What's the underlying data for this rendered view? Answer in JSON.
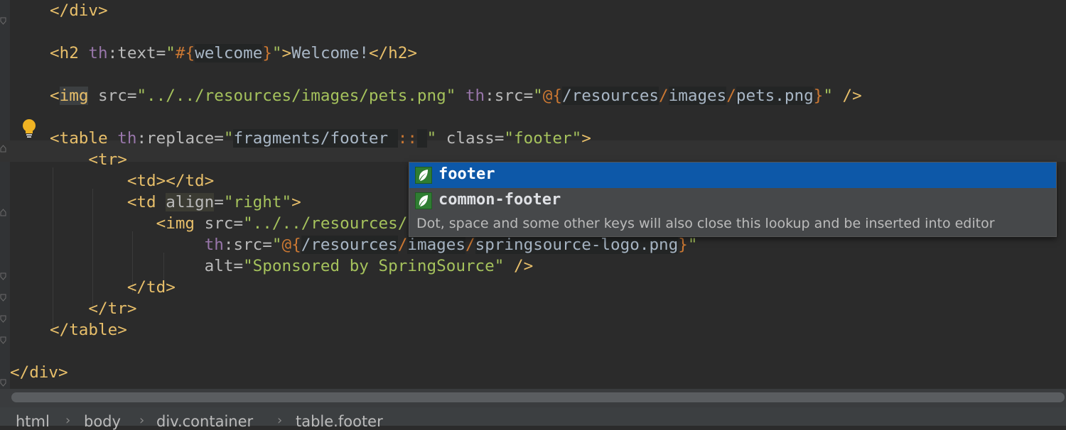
{
  "editor": {
    "lines": [
      {
        "parts": [
          [
            "t",
            "</div>"
          ]
        ]
      },
      {
        "parts": []
      },
      {
        "parts": [
          [
            "t",
            "<h2 "
          ],
          [
            "ns",
            "th"
          ],
          [
            "a",
            ":text="
          ],
          [
            "q",
            "\""
          ],
          [
            "ex",
            "#{"
          ],
          [
            "inj",
            "welcome"
          ],
          [
            "ex",
            "}"
          ],
          [
            "q",
            "\""
          ],
          [
            "t",
            ">"
          ],
          [
            "x",
            "Welcome!"
          ],
          [
            "t",
            "</h2>"
          ]
        ]
      },
      {
        "parts": []
      },
      {
        "parts": [
          [
            "t",
            "<"
          ],
          [
            "thl",
            "img"
          ],
          [
            "a",
            " src="
          ],
          [
            "v",
            "\"../../resources/images/pets.png\""
          ],
          [
            "a",
            " "
          ],
          [
            "ns",
            "th"
          ],
          [
            "a",
            ":src="
          ],
          [
            "q",
            "\""
          ],
          [
            "ex",
            "@{"
          ],
          [
            "inj",
            "/resources"
          ],
          [
            "ex",
            "/"
          ],
          [
            "inj",
            "images"
          ],
          [
            "ex",
            "/"
          ],
          [
            "inj",
            "pets.png"
          ],
          [
            "ex",
            "}"
          ],
          [
            "q",
            "\""
          ],
          [
            "t",
            " />"
          ]
        ]
      },
      {
        "parts": []
      },
      {
        "parts": [
          [
            "t",
            "<table "
          ],
          [
            "ns",
            "th"
          ],
          [
            "a",
            ":replace="
          ],
          [
            "q",
            "\""
          ],
          [
            "inj",
            "fragments/footer "
          ],
          [
            "ex",
            "::"
          ],
          [
            "inj",
            " "
          ],
          [
            "q",
            "\""
          ],
          [
            "a",
            " class="
          ],
          [
            "v",
            "\"footer\""
          ],
          [
            "t",
            ">"
          ]
        ]
      },
      {
        "parts": [
          [
            "t",
            "    <tr>"
          ]
        ]
      },
      {
        "parts": [
          [
            "t",
            "        <td></td>"
          ]
        ]
      },
      {
        "parts": [
          [
            "t",
            "        <td "
          ],
          [
            "ahl",
            "align"
          ],
          [
            "a",
            "="
          ],
          [
            "v",
            "\"right\""
          ],
          [
            "t",
            ">"
          ]
        ]
      },
      {
        "parts": [
          [
            "t",
            "           <img "
          ],
          [
            "a",
            "src="
          ],
          [
            "v",
            "\"../../resources/images/springsource-logo.png\""
          ]
        ]
      },
      {
        "parts": [
          [
            "x",
            "                "
          ],
          [
            "ns",
            "th"
          ],
          [
            "a",
            ":src="
          ],
          [
            "q",
            "\""
          ],
          [
            "ex",
            "@{"
          ],
          [
            "inj",
            "/resources"
          ],
          [
            "ex",
            "/"
          ],
          [
            "inj",
            "images"
          ],
          [
            "ex",
            "/"
          ],
          [
            "inj",
            "springsource-logo.png"
          ],
          [
            "ex",
            "}"
          ],
          [
            "q",
            "\""
          ]
        ]
      },
      {
        "parts": [
          [
            "x",
            "                "
          ],
          [
            "a",
            "alt="
          ],
          [
            "v",
            "\"Sponsored by SpringSource\""
          ],
          [
            "t",
            " />"
          ]
        ]
      },
      {
        "parts": [
          [
            "t",
            "        </td>"
          ]
        ]
      },
      {
        "parts": [
          [
            "t",
            "    </tr>"
          ]
        ]
      },
      {
        "parts": [
          [
            "t",
            "</table>"
          ]
        ]
      },
      {
        "parts": []
      },
      {
        "parts": [
          [
            "t",
            "</div>"
          ]
        ]
      }
    ]
  },
  "completion": {
    "items": [
      {
        "label": "footer",
        "icon": "spring-leaf-icon",
        "selected": true
      },
      {
        "label": "common-footer",
        "icon": "spring-leaf-icon",
        "selected": false
      }
    ],
    "hint": "Dot, space and some other keys will also close this lookup and be inserted into editor"
  },
  "breadcrumbs": [
    "html",
    "body",
    "div.container",
    "table.footer"
  ],
  "colors": {
    "background": "#2b2b2b",
    "tag": "#e8bf6a",
    "attribute": "#bababa",
    "namespace": "#9876aa",
    "string": "#a5c25c",
    "expression": "#cc7832",
    "selection": "#0d58a8",
    "spring_icon": "#2f7d32"
  }
}
